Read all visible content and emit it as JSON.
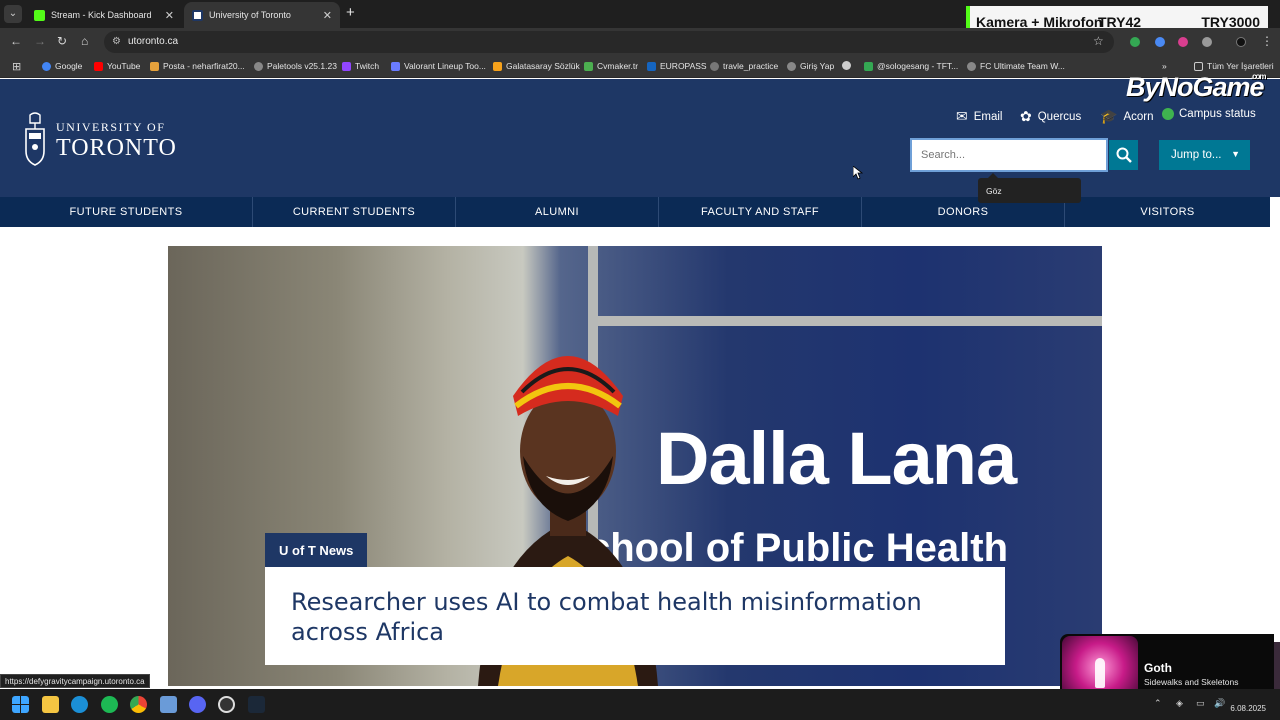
{
  "browser": {
    "tabs": [
      {
        "title": "Stream - Kick Dashboard",
        "favicon_color": "#53fc18",
        "active": false
      },
      {
        "title": "University of Toronto",
        "favicon_color": "#1e3765",
        "active": true
      }
    ],
    "url": "utoronto.ca",
    "bookmarks": [
      {
        "label": "Google",
        "color": "#4285f4"
      },
      {
        "label": "YouTube",
        "color": "#ff0000"
      },
      {
        "label": "Posta - neharfirat20...",
        "color": "#e6a23c"
      },
      {
        "label": "Paletools v25.1.23",
        "color": "#888888"
      },
      {
        "label": "Twitch",
        "color": "#9146ff"
      },
      {
        "label": "Valorant Lineup Too...",
        "color": "#6a7cff"
      },
      {
        "label": "Galatasaray Sözlük",
        "color": "#f7a21b"
      },
      {
        "label": "Cvmaker.tr",
        "color": "#4caf50"
      },
      {
        "label": "EUROPASS",
        "color": "#1565c0"
      },
      {
        "label": "travle_practice",
        "color": "#777777"
      },
      {
        "label": "Giriş Yap",
        "color": "#888888"
      },
      {
        "label": "",
        "color": "#cccccc"
      },
      {
        "label": "@sologesang - TFT...",
        "color": "#34a853"
      },
      {
        "label": "FC Ultimate Team W...",
        "color": "#888888"
      }
    ],
    "all_bookmarks_label": "Tüm Yer İşaretleri",
    "more_bookmarks": "»"
  },
  "overlay": {
    "label": "Kamera + Mikrofon",
    "price1": "TRY42",
    "price2": "TRY3000",
    "accent": "#53fc18"
  },
  "stream_logo": {
    "text": "ByNoGame",
    "small": ".com"
  },
  "site": {
    "logo_line1": "UNIVERSITY OF",
    "logo_line2": "TORONTO",
    "utility_links": [
      {
        "label": "Email",
        "icon": "envelope-icon"
      },
      {
        "label": "Quercus",
        "icon": "quercus-tree-icon"
      },
      {
        "label": "Acorn",
        "icon": "graduation-cap-icon"
      },
      {
        "label": "Campus status",
        "icon": "status-dot-icon"
      }
    ],
    "search_placeholder": "Search...",
    "jump_label": "Jump to...",
    "tooltip": "Göz",
    "brand_color": "#1e3765",
    "accent_color": "#007894",
    "audience_nav": [
      "FUTURE STUDENTS",
      "CURRENT STUDENTS",
      "ALUMNI",
      "FACULTY AND STAFF",
      "DONORS",
      "VISITORS"
    ],
    "hero": {
      "tag": "U of T News",
      "headline": "Researcher uses AI to combat health misinformation across Africa",
      "sign_line1": "Dalla Lana",
      "sign_line2": "chool of Public Health"
    }
  },
  "status_url": "https://defygravitycampaign.utoronto.ca",
  "music": {
    "track": "Goth",
    "artist": "Sidewalks and Skeletons"
  },
  "taskbar": {
    "date": "6.08.2025"
  }
}
